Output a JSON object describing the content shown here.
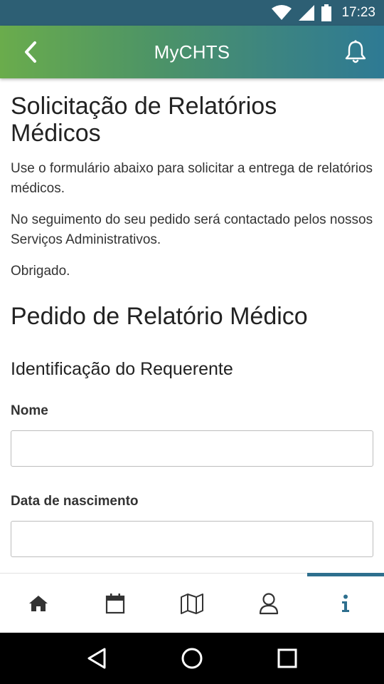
{
  "status_bar": {
    "time": "17:23"
  },
  "app_bar": {
    "title": "MyCHTS"
  },
  "page": {
    "title": "Solicitação de Relatórios Médicos",
    "paragraphs": [
      "Use o formulário abaixo para solicitar a entrega de relatórios médicos.",
      "No seguimento do seu pedido será contactado pelos nossos Serviços Administrativos.",
      "Obrigado."
    ],
    "form_title": "Pedido de Relatório Médico",
    "section_title": "Identificação do Requerente",
    "fields": [
      {
        "label": "Nome",
        "value": ""
      },
      {
        "label": "Data de nascimento",
        "value": ""
      }
    ]
  },
  "bottom_nav": {
    "items": [
      {
        "icon": "home-icon",
        "active": false
      },
      {
        "icon": "calendar-icon",
        "active": false
      },
      {
        "icon": "map-icon",
        "active": false
      },
      {
        "icon": "user-icon",
        "active": false
      },
      {
        "icon": "info-icon",
        "active": true
      }
    ],
    "accent_color": "#2e6f8e"
  },
  "colors": {
    "status_bar": "#2d5f74",
    "app_bar_start": "#6aac4c",
    "app_bar_end": "#2e7a94"
  }
}
